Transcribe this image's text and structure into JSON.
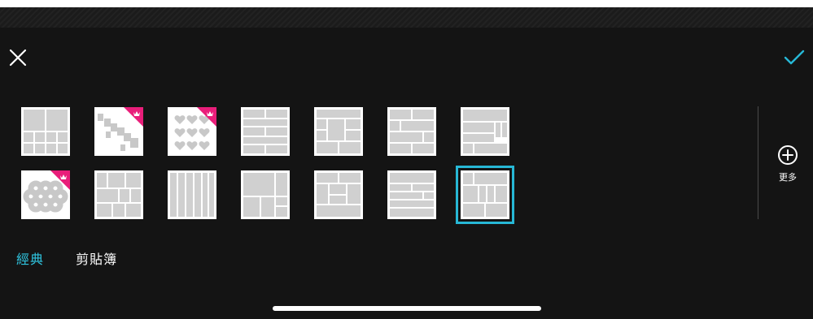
{
  "header": {
    "close_icon": "close-icon",
    "confirm_icon": "check-icon",
    "accent_color": "#27b8d6"
  },
  "layouts": {
    "row1": [
      {
        "name": "layout-1",
        "premium": false
      },
      {
        "name": "layout-2",
        "premium": true
      },
      {
        "name": "layout-3",
        "premium": true
      },
      {
        "name": "layout-4",
        "premium": false
      },
      {
        "name": "layout-5",
        "premium": false
      },
      {
        "name": "layout-6",
        "premium": false
      },
      {
        "name": "layout-7",
        "premium": false
      }
    ],
    "row2": [
      {
        "name": "layout-8",
        "premium": true
      },
      {
        "name": "layout-9",
        "premium": false
      },
      {
        "name": "layout-10",
        "premium": false
      },
      {
        "name": "layout-11",
        "premium": false
      },
      {
        "name": "layout-12",
        "premium": false
      },
      {
        "name": "layout-13",
        "premium": false
      },
      {
        "name": "layout-14",
        "premium": false,
        "selected": true
      }
    ],
    "premium_badge_color": "#e91e7a"
  },
  "more": {
    "label": "更多",
    "icon": "plus-circle-icon"
  },
  "tabs": [
    {
      "label": "經典",
      "active": true
    },
    {
      "label": "剪貼簿",
      "active": false
    }
  ]
}
